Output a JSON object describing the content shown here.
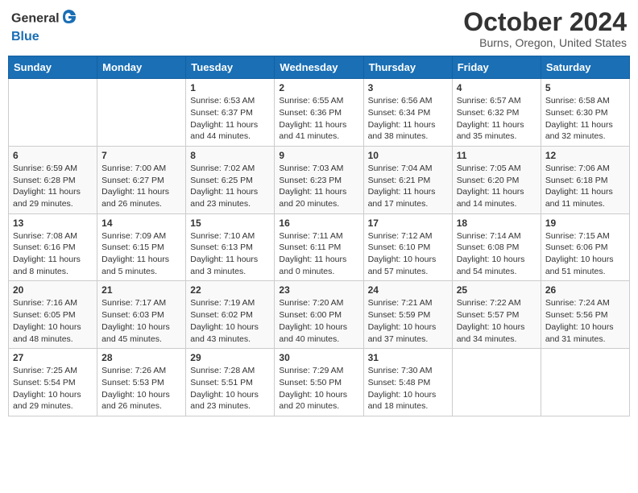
{
  "header": {
    "logo_general": "General",
    "logo_blue": "Blue",
    "month": "October 2024",
    "location": "Burns, Oregon, United States"
  },
  "weekdays": [
    "Sunday",
    "Monday",
    "Tuesday",
    "Wednesday",
    "Thursday",
    "Friday",
    "Saturday"
  ],
  "weeks": [
    [
      {
        "day": "",
        "sunrise": "",
        "sunset": "",
        "daylight": ""
      },
      {
        "day": "",
        "sunrise": "",
        "sunset": "",
        "daylight": ""
      },
      {
        "day": "1",
        "sunrise": "Sunrise: 6:53 AM",
        "sunset": "Sunset: 6:37 PM",
        "daylight": "Daylight: 11 hours and 44 minutes."
      },
      {
        "day": "2",
        "sunrise": "Sunrise: 6:55 AM",
        "sunset": "Sunset: 6:36 PM",
        "daylight": "Daylight: 11 hours and 41 minutes."
      },
      {
        "day": "3",
        "sunrise": "Sunrise: 6:56 AM",
        "sunset": "Sunset: 6:34 PM",
        "daylight": "Daylight: 11 hours and 38 minutes."
      },
      {
        "day": "4",
        "sunrise": "Sunrise: 6:57 AM",
        "sunset": "Sunset: 6:32 PM",
        "daylight": "Daylight: 11 hours and 35 minutes."
      },
      {
        "day": "5",
        "sunrise": "Sunrise: 6:58 AM",
        "sunset": "Sunset: 6:30 PM",
        "daylight": "Daylight: 11 hours and 32 minutes."
      }
    ],
    [
      {
        "day": "6",
        "sunrise": "Sunrise: 6:59 AM",
        "sunset": "Sunset: 6:28 PM",
        "daylight": "Daylight: 11 hours and 29 minutes."
      },
      {
        "day": "7",
        "sunrise": "Sunrise: 7:00 AM",
        "sunset": "Sunset: 6:27 PM",
        "daylight": "Daylight: 11 hours and 26 minutes."
      },
      {
        "day": "8",
        "sunrise": "Sunrise: 7:02 AM",
        "sunset": "Sunset: 6:25 PM",
        "daylight": "Daylight: 11 hours and 23 minutes."
      },
      {
        "day": "9",
        "sunrise": "Sunrise: 7:03 AM",
        "sunset": "Sunset: 6:23 PM",
        "daylight": "Daylight: 11 hours and 20 minutes."
      },
      {
        "day": "10",
        "sunrise": "Sunrise: 7:04 AM",
        "sunset": "Sunset: 6:21 PM",
        "daylight": "Daylight: 11 hours and 17 minutes."
      },
      {
        "day": "11",
        "sunrise": "Sunrise: 7:05 AM",
        "sunset": "Sunset: 6:20 PM",
        "daylight": "Daylight: 11 hours and 14 minutes."
      },
      {
        "day": "12",
        "sunrise": "Sunrise: 7:06 AM",
        "sunset": "Sunset: 6:18 PM",
        "daylight": "Daylight: 11 hours and 11 minutes."
      }
    ],
    [
      {
        "day": "13",
        "sunrise": "Sunrise: 7:08 AM",
        "sunset": "Sunset: 6:16 PM",
        "daylight": "Daylight: 11 hours and 8 minutes."
      },
      {
        "day": "14",
        "sunrise": "Sunrise: 7:09 AM",
        "sunset": "Sunset: 6:15 PM",
        "daylight": "Daylight: 11 hours and 5 minutes."
      },
      {
        "day": "15",
        "sunrise": "Sunrise: 7:10 AM",
        "sunset": "Sunset: 6:13 PM",
        "daylight": "Daylight: 11 hours and 3 minutes."
      },
      {
        "day": "16",
        "sunrise": "Sunrise: 7:11 AM",
        "sunset": "Sunset: 6:11 PM",
        "daylight": "Daylight: 11 hours and 0 minutes."
      },
      {
        "day": "17",
        "sunrise": "Sunrise: 7:12 AM",
        "sunset": "Sunset: 6:10 PM",
        "daylight": "Daylight: 10 hours and 57 minutes."
      },
      {
        "day": "18",
        "sunrise": "Sunrise: 7:14 AM",
        "sunset": "Sunset: 6:08 PM",
        "daylight": "Daylight: 10 hours and 54 minutes."
      },
      {
        "day": "19",
        "sunrise": "Sunrise: 7:15 AM",
        "sunset": "Sunset: 6:06 PM",
        "daylight": "Daylight: 10 hours and 51 minutes."
      }
    ],
    [
      {
        "day": "20",
        "sunrise": "Sunrise: 7:16 AM",
        "sunset": "Sunset: 6:05 PM",
        "daylight": "Daylight: 10 hours and 48 minutes."
      },
      {
        "day": "21",
        "sunrise": "Sunrise: 7:17 AM",
        "sunset": "Sunset: 6:03 PM",
        "daylight": "Daylight: 10 hours and 45 minutes."
      },
      {
        "day": "22",
        "sunrise": "Sunrise: 7:19 AM",
        "sunset": "Sunset: 6:02 PM",
        "daylight": "Daylight: 10 hours and 43 minutes."
      },
      {
        "day": "23",
        "sunrise": "Sunrise: 7:20 AM",
        "sunset": "Sunset: 6:00 PM",
        "daylight": "Daylight: 10 hours and 40 minutes."
      },
      {
        "day": "24",
        "sunrise": "Sunrise: 7:21 AM",
        "sunset": "Sunset: 5:59 PM",
        "daylight": "Daylight: 10 hours and 37 minutes."
      },
      {
        "day": "25",
        "sunrise": "Sunrise: 7:22 AM",
        "sunset": "Sunset: 5:57 PM",
        "daylight": "Daylight: 10 hours and 34 minutes."
      },
      {
        "day": "26",
        "sunrise": "Sunrise: 7:24 AM",
        "sunset": "Sunset: 5:56 PM",
        "daylight": "Daylight: 10 hours and 31 minutes."
      }
    ],
    [
      {
        "day": "27",
        "sunrise": "Sunrise: 7:25 AM",
        "sunset": "Sunset: 5:54 PM",
        "daylight": "Daylight: 10 hours and 29 minutes."
      },
      {
        "day": "28",
        "sunrise": "Sunrise: 7:26 AM",
        "sunset": "Sunset: 5:53 PM",
        "daylight": "Daylight: 10 hours and 26 minutes."
      },
      {
        "day": "29",
        "sunrise": "Sunrise: 7:28 AM",
        "sunset": "Sunset: 5:51 PM",
        "daylight": "Daylight: 10 hours and 23 minutes."
      },
      {
        "day": "30",
        "sunrise": "Sunrise: 7:29 AM",
        "sunset": "Sunset: 5:50 PM",
        "daylight": "Daylight: 10 hours and 20 minutes."
      },
      {
        "day": "31",
        "sunrise": "Sunrise: 7:30 AM",
        "sunset": "Sunset: 5:48 PM",
        "daylight": "Daylight: 10 hours and 18 minutes."
      },
      {
        "day": "",
        "sunrise": "",
        "sunset": "",
        "daylight": ""
      },
      {
        "day": "",
        "sunrise": "",
        "sunset": "",
        "daylight": ""
      }
    ]
  ]
}
